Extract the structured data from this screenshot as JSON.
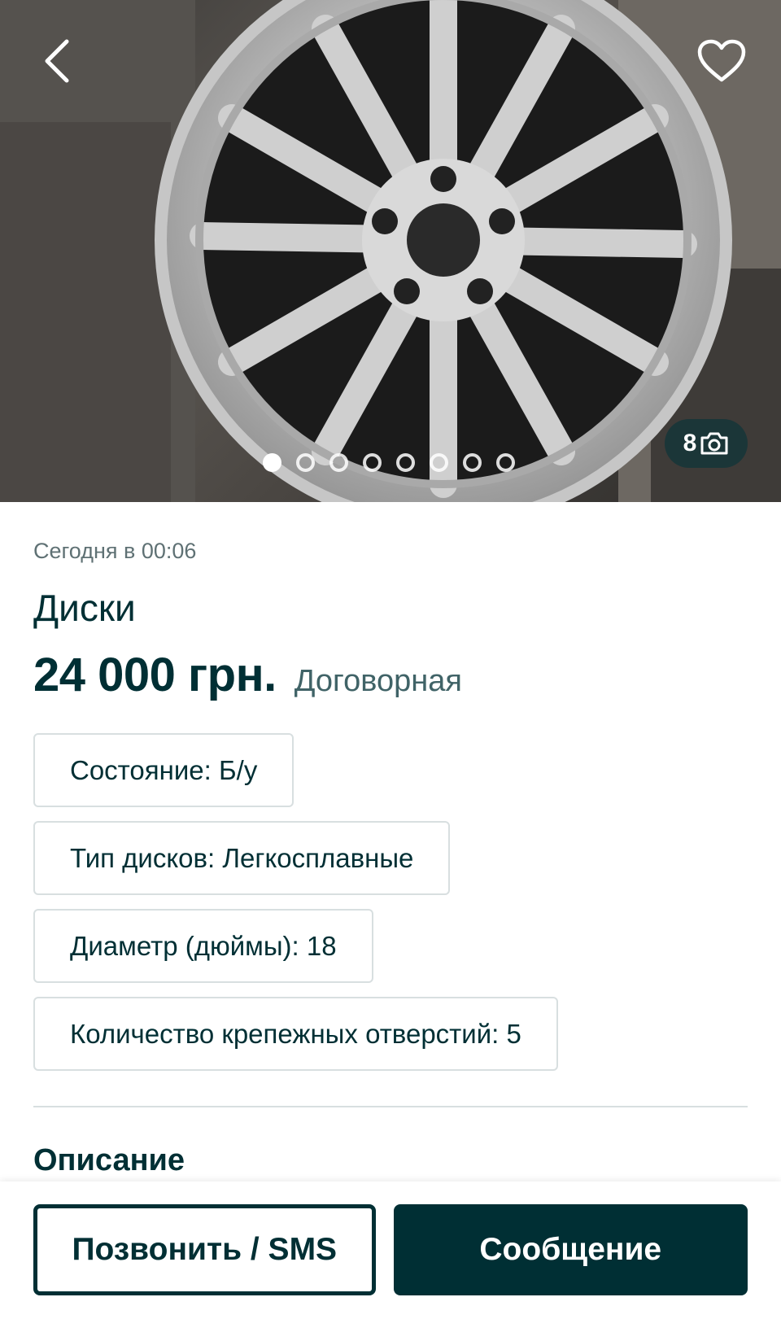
{
  "gallery": {
    "image_alt": "Диски",
    "photo_count": "8",
    "total_dots": 8,
    "active_dot": 0,
    "icons": {
      "back": "chevron-left-icon",
      "favorite": "heart-icon",
      "camera": "camera-icon"
    }
  },
  "listing": {
    "posted": "Сегодня в 00:06",
    "title": "Диски",
    "price": "24 000 грн.",
    "negotiable": "Договорная",
    "params": [
      "Состояние: Б/у",
      "Тип дисков: Легкосплавные",
      "Диаметр (дюймы): 18",
      "Количество крепежных отверстий: 5"
    ],
    "description_title": "Описание"
  },
  "actions": {
    "call_label": "Позвонить / SMS",
    "message_label": "Сообщение"
  },
  "colors": {
    "primary": "#002f34",
    "muted": "#5f7174",
    "border": "#d8dfe0"
  }
}
